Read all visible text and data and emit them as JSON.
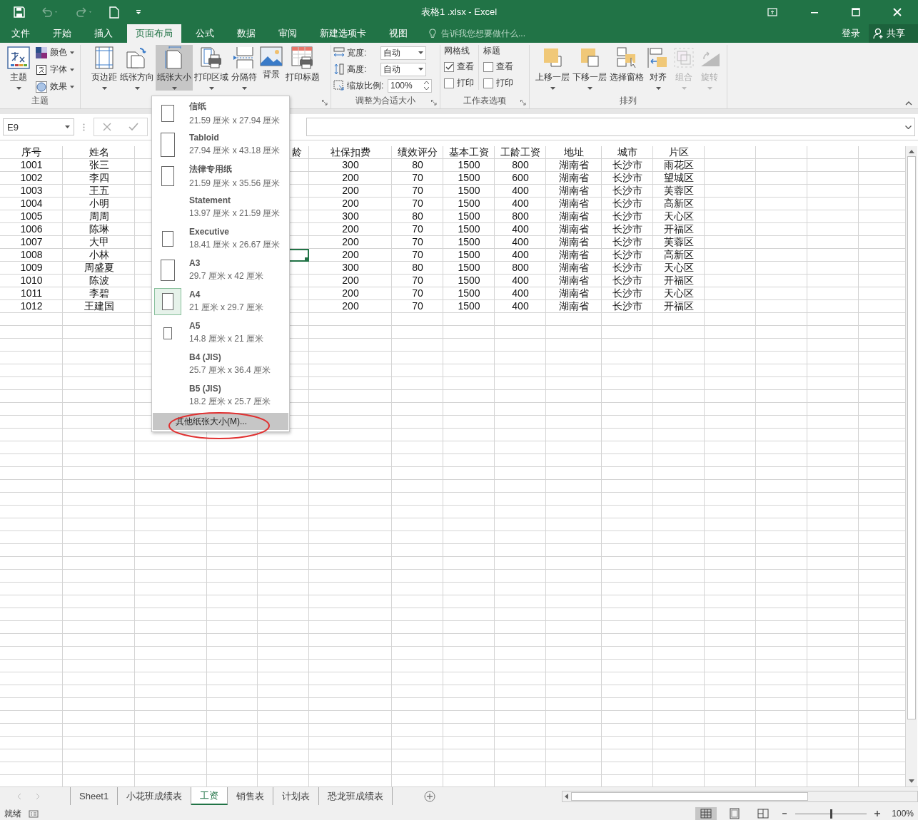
{
  "window": {
    "title": "表格1 .xlsx - Excel"
  },
  "ribbon_tabs": [
    {
      "label": "文件",
      "selected": false
    },
    {
      "label": "开始",
      "selected": false
    },
    {
      "label": "插入",
      "selected": false
    },
    {
      "label": "页面布局",
      "selected": true
    },
    {
      "label": "公式",
      "selected": false
    },
    {
      "label": "数据",
      "selected": false
    },
    {
      "label": "审阅",
      "selected": false
    },
    {
      "label": "新建选项卡",
      "selected": false
    },
    {
      "label": "视图",
      "selected": false
    }
  ],
  "tell_me": {
    "placeholder": "告诉我您想要做什么..."
  },
  "account": {
    "sign_in": "登录",
    "share": "共享"
  },
  "ribbon": {
    "themes": {
      "label": "主题",
      "button": "主题",
      "options": [
        "颜色",
        "字体",
        "效果"
      ]
    },
    "page_setup": {
      "buttons": [
        {
          "label": "页边距",
          "kind": "margins",
          "dropdown": true,
          "selected": false
        },
        {
          "label": "纸张方向",
          "kind": "orientation",
          "dropdown": true,
          "selected": false
        },
        {
          "label": "纸张大小",
          "kind": "size",
          "dropdown": true,
          "selected": true
        },
        {
          "label": "打印区域",
          "kind": "printarea",
          "dropdown": true,
          "selected": false
        },
        {
          "label": "分隔符",
          "kind": "breaks",
          "dropdown": true,
          "selected": false
        },
        {
          "label": "背景",
          "kind": "background",
          "dropdown": false,
          "selected": false
        },
        {
          "label": "打印标题",
          "kind": "titles",
          "dropdown": false,
          "selected": false
        }
      ]
    },
    "scale_to_fit": {
      "label": "调整为合适大小",
      "fields": [
        {
          "label": "宽度:",
          "value": "自动",
          "kind": "dropdown"
        },
        {
          "label": "高度:",
          "value": "自动",
          "kind": "dropdown"
        },
        {
          "label": "缩放比例:",
          "value": "100%",
          "kind": "spinner"
        }
      ]
    },
    "sheet_options": {
      "label": "工作表选项",
      "columns": [
        {
          "title": "网格线",
          "options": [
            {
              "label": "查看",
              "checked": true
            },
            {
              "label": "打印",
              "checked": false
            }
          ]
        },
        {
          "title": "标题",
          "options": [
            {
              "label": "查看",
              "checked": false
            },
            {
              "label": "打印",
              "checked": false
            }
          ]
        }
      ]
    },
    "arrange": {
      "label": "排列",
      "buttons": [
        {
          "label": "上移一层",
          "kind": "forward",
          "dropdown": true,
          "disabled": false
        },
        {
          "label": "下移一层",
          "kind": "backward",
          "dropdown": true,
          "disabled": false
        },
        {
          "label": "选择窗格",
          "kind": "pane",
          "dropdown": false,
          "disabled": false
        },
        {
          "label": "对齐",
          "kind": "align",
          "dropdown": true,
          "disabled": false
        },
        {
          "label": "组合",
          "kind": "group",
          "dropdown": true,
          "disabled": true
        },
        {
          "label": "旋转",
          "kind": "rotate",
          "dropdown": true,
          "disabled": true
        }
      ]
    }
  },
  "name_box": "E9",
  "paper_menu": {
    "items": [
      {
        "name": "信纸",
        "size": "21.59 厘米 x 27.94 厘米",
        "kind": "letter",
        "selected": false
      },
      {
        "name": "Tabloid",
        "size": "27.94 厘米 x 43.18 厘米",
        "kind": "tabloid",
        "selected": false
      },
      {
        "name": "法律专用纸",
        "size": "21.59 厘米 x 35.56 厘米",
        "kind": "legal",
        "selected": false
      },
      {
        "name": "Statement",
        "size": "13.97 厘米 x 21.59 厘米",
        "kind": "none",
        "selected": false
      },
      {
        "name": "Executive",
        "size": "18.41 厘米 x 26.67 厘米",
        "kind": "executive",
        "selected": false
      },
      {
        "name": "A3",
        "size": "29.7 厘米 x 42 厘米",
        "kind": "a3",
        "selected": false
      },
      {
        "name": "A4",
        "size": "21 厘米 x 29.7 厘米",
        "kind": "a4",
        "selected": true
      },
      {
        "name": "A5",
        "size": "14.8 厘米 x 21 厘米",
        "kind": "a5",
        "selected": false
      },
      {
        "name": "B4 (JIS)",
        "size": "25.7 厘米 x 36.4 厘米",
        "kind": "none",
        "selected": false
      },
      {
        "name": "B5 (JIS)",
        "size": "18.2 厘米 x 25.7 厘米",
        "kind": "none",
        "selected": false
      }
    ],
    "more": {
      "label": "其他纸张大小(M)...",
      "circled": true
    }
  },
  "table": {
    "covered_header": "龄",
    "columns": [
      "序号",
      "姓名",
      "社保扣费",
      "绩效评分",
      "基本工资",
      "工龄工资",
      "地址",
      "城市",
      "片区"
    ],
    "rows": [
      {
        "cells": [
          "1001",
          "张三",
          "300",
          "80",
          "1500",
          "800",
          "湖南省",
          "长沙市",
          "雨花区"
        ],
        "cursor": false
      },
      {
        "cells": [
          "1002",
          "李四",
          "200",
          "70",
          "1500",
          "600",
          "湖南省",
          "长沙市",
          "望城区"
        ],
        "cursor": false
      },
      {
        "cells": [
          "1003",
          "王五",
          "200",
          "70",
          "1500",
          "400",
          "湖南省",
          "长沙市",
          "芙蓉区"
        ],
        "cursor": false
      },
      {
        "cells": [
          "1004",
          "小明",
          "200",
          "70",
          "1500",
          "400",
          "湖南省",
          "长沙市",
          "高新区"
        ],
        "cursor": false
      },
      {
        "cells": [
          "1005",
          "周周",
          "300",
          "80",
          "1500",
          "800",
          "湖南省",
          "长沙市",
          "天心区"
        ],
        "cursor": false
      },
      {
        "cells": [
          "1006",
          "陈琳",
          "200",
          "70",
          "1500",
          "400",
          "湖南省",
          "长沙市",
          "开福区"
        ],
        "cursor": false
      },
      {
        "cells": [
          "1007",
          "大甲",
          "200",
          "70",
          "1500",
          "400",
          "湖南省",
          "长沙市",
          "芙蓉区"
        ],
        "cursor": false
      },
      {
        "cells": [
          "1008",
          "小林",
          "200",
          "70",
          "1500",
          "400",
          "湖南省",
          "长沙市",
          "高新区"
        ],
        "cursor": true
      },
      {
        "cells": [
          "1009",
          "周盛夏",
          "300",
          "80",
          "1500",
          "800",
          "湖南省",
          "长沙市",
          "天心区"
        ],
        "cursor": false
      },
      {
        "cells": [
          "1010",
          "陈波",
          "200",
          "70",
          "1500",
          "400",
          "湖南省",
          "长沙市",
          "开福区"
        ],
        "cursor": false
      },
      {
        "cells": [
          "1011",
          "李碧",
          "200",
          "70",
          "1500",
          "400",
          "湖南省",
          "长沙市",
          "天心区"
        ],
        "cursor": false
      },
      {
        "cells": [
          "1012",
          "王建国",
          "200",
          "70",
          "1500",
          "400",
          "湖南省",
          "长沙市",
          "开福区"
        ],
        "cursor": false
      }
    ]
  },
  "sheet_tabs": [
    {
      "label": "Sheet1",
      "selected": false
    },
    {
      "label": "小花班成绩表",
      "selected": false
    },
    {
      "label": "工资",
      "selected": true
    },
    {
      "label": "销售表",
      "selected": false
    },
    {
      "label": "计划表",
      "selected": false
    },
    {
      "label": "恐龙班成绩表",
      "selected": false
    }
  ],
  "status_bar": {
    "status": "就绪",
    "zoom": {
      "level": 0.5,
      "reading": "100%"
    }
  }
}
